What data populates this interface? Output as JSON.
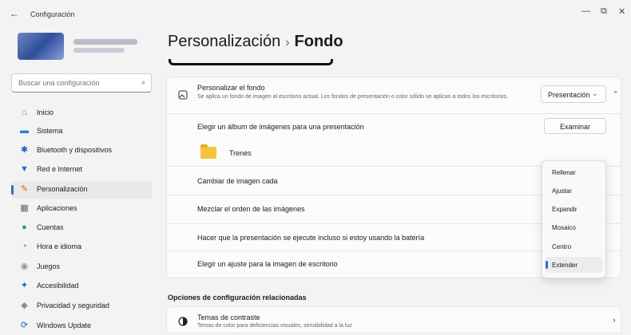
{
  "window": {
    "title": "Configuración",
    "back_icon": "←",
    "minimize": "—",
    "maximize": "⧉",
    "close": "✕"
  },
  "sidebar": {
    "search_placeholder": "Buscar una configuración",
    "items": [
      {
        "label": "Inicio",
        "icon": "home-icon",
        "glyph": "⌂",
        "color": "#e06b2a"
      },
      {
        "label": "Sistema",
        "icon": "monitor-icon",
        "glyph": "▬",
        "color": "#2e7bd1"
      },
      {
        "label": "Bluetooth y dispositivos",
        "icon": "bluetooth-icon",
        "glyph": "✱",
        "color": "#1a5fc4"
      },
      {
        "label": "Red e Internet",
        "icon": "wifi-icon",
        "glyph": "▼",
        "color": "#1f6fd6"
      },
      {
        "label": "Personalización",
        "icon": "brush-icon",
        "glyph": "✎",
        "color": "#d56a2c"
      },
      {
        "label": "Aplicaciones",
        "icon": "apps-icon",
        "glyph": "▦",
        "color": "#56677e"
      },
      {
        "label": "Cuentas",
        "icon": "user-icon",
        "glyph": "●",
        "color": "#2fa34b"
      },
      {
        "label": "Hora e idioma",
        "icon": "globe-icon",
        "glyph": "◔",
        "color": "#2b84cf"
      },
      {
        "label": "Juegos",
        "icon": "controller-icon",
        "glyph": "◉",
        "color": "#8893a3"
      },
      {
        "label": "Accesibilidad",
        "icon": "accessibility-icon",
        "glyph": "✦",
        "color": "#1d62c9"
      },
      {
        "label": "Privacidad y seguridad",
        "icon": "shield-icon",
        "glyph": "◆",
        "color": "#8790a0"
      },
      {
        "label": "Windows Update",
        "icon": "update-icon",
        "glyph": "⟳",
        "color": "#1d62c9"
      }
    ],
    "active_index": 4
  },
  "header": {
    "parent": "Personalización",
    "separator": "›",
    "current": "Fondo"
  },
  "background_card": {
    "title": "Personalizar el fondo",
    "description": "Se aplica un fondo de imagen al escritorio actual. Los fondos de presentación o color sólido se aplican a todos los escritorios.",
    "dropdown_value": "Presentación",
    "dropdown_chevron": "⌄",
    "collapse_chevron": "⌃"
  },
  "rows": {
    "album_label": "Elegir un álbum de imágenes para una presentación",
    "browse_label": "Examinar",
    "folder_name": "Trenes",
    "interval_label": "Cambiar de imagen cada",
    "shuffle_label": "Mezclar el orden de las imágenes",
    "battery_label": "Hacer que la presentación se ejecute incluso si estoy usando la batería",
    "fit_label": "Elegir un ajuste para la imagen de escritorio"
  },
  "fit_menu": {
    "options": [
      "Rellenar",
      "Ajustar",
      "Expandir",
      "Mosaico",
      "Centro",
      "Extender"
    ],
    "selected_index": 5
  },
  "related": {
    "heading": "Opciones de configuración relacionadas",
    "contrast_title": "Temas de contraste",
    "contrast_desc": "Temas de color para deficiencias visuales, sensibilidad a la luz",
    "chevron": "›"
  },
  "colors": {
    "accent": "#3a67c8",
    "sidebar_active_bg": "#e9e9e9",
    "card_bg": "#fbfbfb"
  }
}
